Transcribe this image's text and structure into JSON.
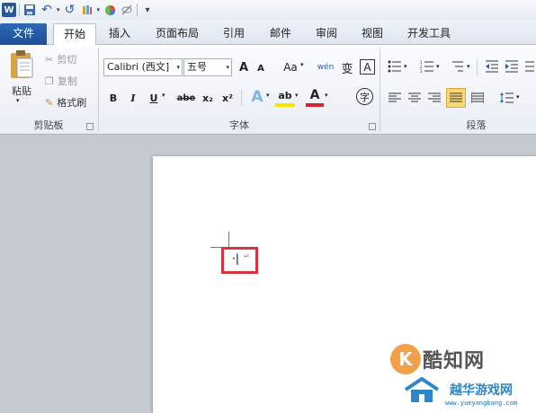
{
  "quick_access": {
    "word_logo": "W",
    "undo": "↶",
    "redo": "↺",
    "customize": "▾"
  },
  "tabs": [
    {
      "label": "文件",
      "active": false
    },
    {
      "label": "开始",
      "active": true
    },
    {
      "label": "插入",
      "active": false
    },
    {
      "label": "页面布局",
      "active": false
    },
    {
      "label": "引用",
      "active": false
    },
    {
      "label": "邮件",
      "active": false
    },
    {
      "label": "审阅",
      "active": false
    },
    {
      "label": "视图",
      "active": false
    },
    {
      "label": "开发工具",
      "active": false
    }
  ],
  "clipboard": {
    "paste": "粘贴",
    "cut": "剪切",
    "copy": "复制",
    "format_painter": "格式刷",
    "group": "剪贴板"
  },
  "font": {
    "font_name": "Calibri (西文]",
    "font_size": "五号",
    "grow": "A",
    "shrink": "A",
    "change_case": "Aa",
    "phonetic": "wén",
    "char_border": "A",
    "pinyin_char": "变",
    "bold": "B",
    "italic": "I",
    "underline": "U",
    "strike": "abe",
    "subscript": "x₂",
    "superscript": "x²",
    "text_effect": "A",
    "highlight": "ab",
    "font_color": "A",
    "enclose": "字",
    "group": "字体"
  },
  "paragraph": {
    "group": "段落"
  },
  "document": {
    "cursor_mark": "·|",
    "para_mark": "↵"
  },
  "watermark": {
    "brand": "酷知网",
    "sub": "越华游戏网",
    "url": "www.yueyangbang.com",
    "k": "K"
  },
  "colors": {
    "accent": "#2b579a",
    "highlight_box": "#d9343d",
    "wm_orange": "#f2a04a",
    "wm_blue": "#2c86c9"
  }
}
